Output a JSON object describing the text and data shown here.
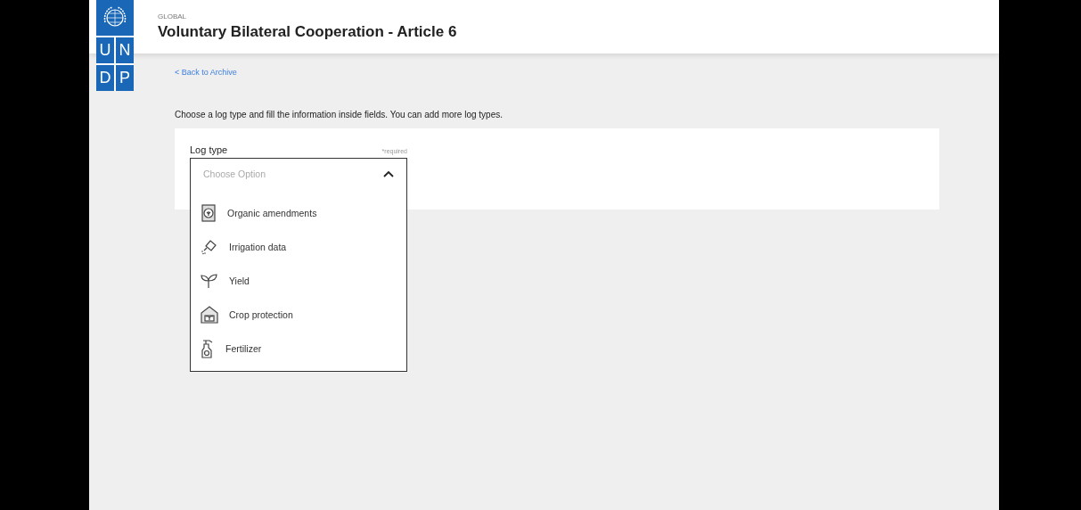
{
  "logo": {
    "letters": [
      "U",
      "N",
      "D",
      "P"
    ]
  },
  "header": {
    "eyebrow": "GLOBAL",
    "title": "Voluntary Bilateral Cooperation - Article 6"
  },
  "back_link": "< Back to Archive",
  "instructions": "Choose a log type and fill the information inside fields. You can add more log types.",
  "log_type": {
    "label": "Log type",
    "required_note": "*required",
    "placeholder": "Choose Option",
    "expanded": true,
    "options": [
      {
        "label": "Organic amendments"
      },
      {
        "label": "Irrigation data"
      },
      {
        "label": "Yield"
      },
      {
        "label": "Crop protection"
      },
      {
        "label": "Fertilizer"
      }
    ]
  }
}
